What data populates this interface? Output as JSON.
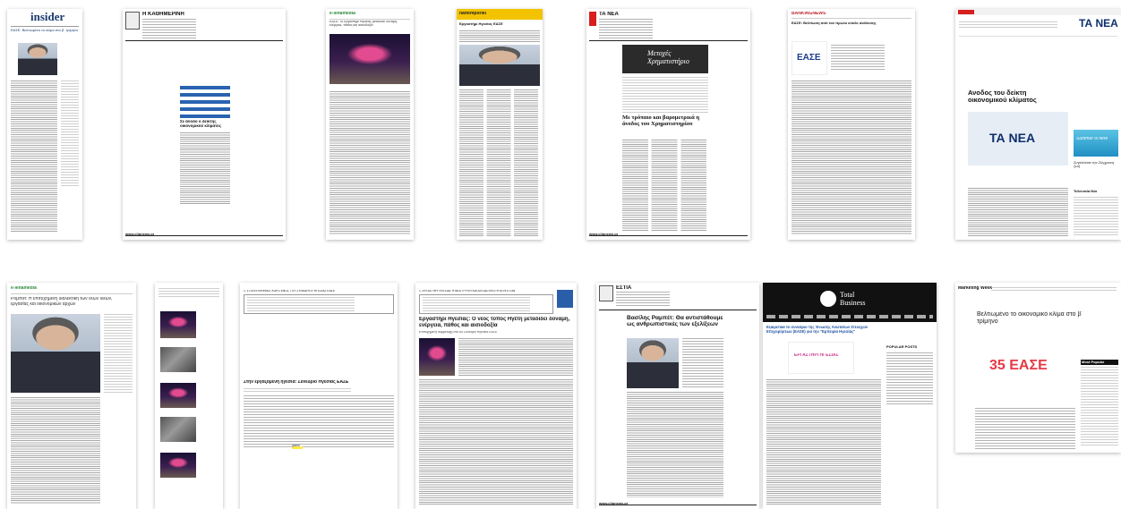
{
  "thumbnails": [
    {
      "id": 1,
      "masthead": "insider",
      "headline": "ΕΑΣΕ: Βελτιωμένο το κλίμα στο β΄ τρίμηνο"
    },
    {
      "id": 2,
      "masthead": "Η ΚΑΘΗΜΕΡΙΝΗ",
      "headline": "Σε άνοδο ο δείκτης οικονομικού κλίματος",
      "footer": "www.clipnews.gr"
    },
    {
      "id": 3,
      "masthead": "e-lenamedia",
      "headline": "ΕΑΣΕ: Το Εργαστήρι Ηγεσίας μεταδίδει δύναμη, ενέργεια, πάθος και αισιοδοξία"
    },
    {
      "id": 4,
      "masthead": "naftemporiki",
      "headline": "Εργαστήρι Ηγεσίας ΕΑΣΕ"
    },
    {
      "id": 5,
      "masthead": "ΤΑ ΝΕΑ",
      "headline": "Μετοχές Χρηματιστήριο",
      "subheadline": "Με τρόπαιο και βαρομετρικά η άνοδος του Χρηματιστηρίου",
      "footer": "www.clipnews.gr"
    },
    {
      "id": 6,
      "masthead": "BANKINGNEWS",
      "headline": "ΕΑΣΕ: Βελτίωση από τον πρώτο κύκλο ανάλυσης",
      "logo": "ΕΑΣΕ"
    },
    {
      "id": 7,
      "masthead": "ΤΑ ΝΕΑ",
      "headline": "Ανοδος του δείκτη οικονομικού κλίματος",
      "logo": "ΤΑ ΝΕΑ",
      "banner": "Summer is here",
      "banner2": "Συγκλόνισε την Σύγχρονη ζωή",
      "sidebar_title": "Τελευταία Νέα"
    },
    {
      "id": 8,
      "masthead": "e-lenamedia",
      "headline": "Ρομπότ: Η επιτυχημένη διαλεκτική των νέων ιδεών, εργασίας και οικονομικών αρχών"
    },
    {
      "id": 9,
      "masthead": "",
      "headline": ""
    },
    {
      "id": 10,
      "masthead": "",
      "source_line": "1. ΣΤΟΝ ΕΛΛΗΝΙΚΟ ΧΩΡΟ ΕΝΟΣ ΤΟΥ ΣΥΝΕΔΡΙΟΥ ΗΓΕΣΙΑΣ ΕΑΣΕ",
      "headline": "Στην εργαζόμενη ηγεσία: Συνέδριο Ηγεσίας ΕΑΣΕ",
      "highlight": "Ιβάνο"
    },
    {
      "id": 11,
      "masthead": "",
      "source_line": "1. ΕΡΓΑΣΤΗΡΙ ΗΓΕΣΙΑΣ Η ΝΕΑ ΤΡΥΠΗ ΚΑΙ ΑΠΟΔΟΤΙΚΟΤΗΤΑ ΗΓΕΤΩΝ",
      "headline": "Εργαστήρι Ηγεσίας: Ο νέος τύπος Ηγέτη μεταδίδει δύναμη, ενέργεια, πάθος και αισιοδοξία",
      "subheadline": "Επιτυχημένη συμμετοχή στο 6ο Συνέδριο Ηγεσίας ΕΑΣΕ"
    },
    {
      "id": 12,
      "masthead": "ΕΣΤΙΑ",
      "headline": "Βασίλης Ραμπέτ: Θα αντιστάθουμε ως ανθρωπιστικές των εξελίξεων",
      "footer": "www.clipnews.gr"
    },
    {
      "id": 13,
      "masthead": "Total Business",
      "headline": "Εξαιρετικά το συνέδριο της Ένωσης Ανώτατων Στελεχών Επιχειρήσεων (ΕΑΣΕ) για την \"Εμπειρία Ηγεσίας\"",
      "sidebar_title": "POPULAR POSTS",
      "event_logo": "ΕΡΓΑΣΤΗΡΙ ΗΓΕΣΙΑΣ"
    },
    {
      "id": 14,
      "masthead": "Marketing Week",
      "headline": "Βελτιωμένο το οικονομικό κλίμα στο β΄ τρίμηνο",
      "logo": "35 ΕΑΣΕ",
      "sidebar_title": "Most Popular"
    }
  ]
}
